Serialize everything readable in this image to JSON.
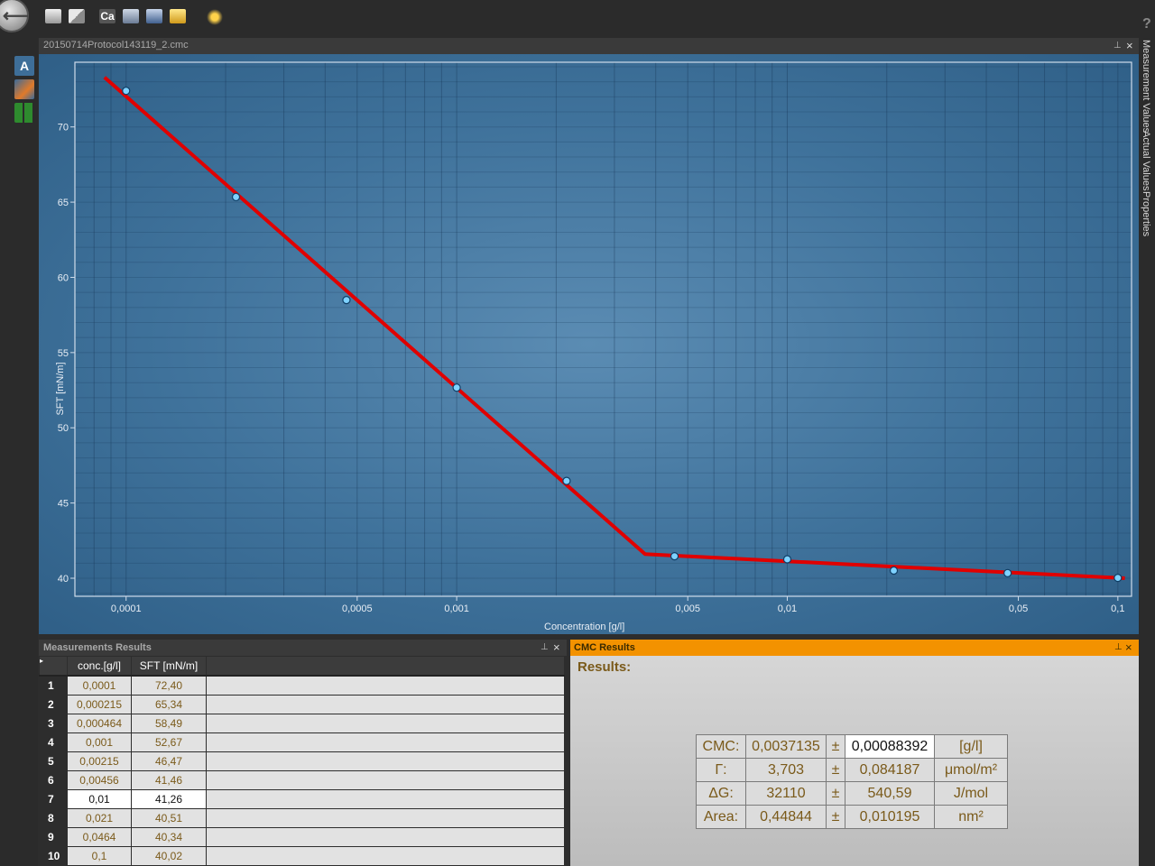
{
  "toolbar": {
    "buttons": [
      {
        "name": "new-folder-icon",
        "label": ""
      },
      {
        "name": "window-icon",
        "label": ""
      },
      {
        "name": "calibrate-button",
        "label": "Ca"
      },
      {
        "name": "print-icon",
        "label": ""
      },
      {
        "name": "save-icon",
        "label": ""
      },
      {
        "name": "open-folder-icon",
        "label": ""
      },
      {
        "name": "wizard-icon",
        "label": ""
      }
    ],
    "help_label": "?"
  },
  "left_rail": {
    "button_a_label": "A"
  },
  "document": {
    "title": "20150714Protocol143119_2.cmc",
    "pin": "⊥",
    "close": "×"
  },
  "chart_data": {
    "type": "line",
    "x_scale": "log",
    "xlabel": "Concentration [g/l]",
    "ylabel": "SFT [mN/m]",
    "xlim": [
      7e-05,
      0.11
    ],
    "ylim": [
      38.8,
      74.3
    ],
    "x_ticks": [
      {
        "value": 0.0001,
        "label": "0,0001"
      },
      {
        "value": 0.0005,
        "label": "0,0005"
      },
      {
        "value": 0.001,
        "label": "0,001"
      },
      {
        "value": 0.005,
        "label": "0,005"
      },
      {
        "value": 0.01,
        "label": "0,01"
      },
      {
        "value": 0.05,
        "label": "0,05"
      },
      {
        "value": 0.1,
        "label": "0,1"
      }
    ],
    "y_ticks": [
      {
        "value": 40,
        "label": "40"
      },
      {
        "value": 45,
        "label": "45"
      },
      {
        "value": 50,
        "label": "50"
      },
      {
        "value": 55,
        "label": "55"
      },
      {
        "value": 60,
        "label": "60"
      },
      {
        "value": 65,
        "label": "65"
      },
      {
        "value": 70,
        "label": "70"
      }
    ],
    "series": [
      {
        "type": "scatter",
        "x": [
          0.0001,
          0.000215,
          0.000464,
          0.001,
          0.00215,
          0.00456,
          0.01,
          0.021,
          0.0464,
          0.1
        ],
        "y": [
          72.4,
          65.34,
          58.49,
          52.67,
          46.47,
          41.46,
          41.26,
          40.51,
          40.34,
          40.02
        ]
      },
      {
        "type": "line",
        "x": [
          8.6e-05,
          0.0037135,
          0.105
        ],
        "y": [
          73.3,
          41.6,
          40.0
        ],
        "color": "#e00000"
      }
    ],
    "grid": true
  },
  "right_dock": {
    "tabs": [
      "Measurement Values",
      "Actual Values",
      "Properties"
    ]
  },
  "measurements": {
    "title": "Measurements Results",
    "columns": [
      "conc.[g/l]",
      "SFT [mN/m]"
    ],
    "rows": [
      {
        "n": "1",
        "conc": "0,0001",
        "sft": "72,40"
      },
      {
        "n": "2",
        "conc": "0,000215",
        "sft": "65,34"
      },
      {
        "n": "3",
        "conc": "0,000464",
        "sft": "58,49"
      },
      {
        "n": "4",
        "conc": "0,001",
        "sft": "52,67"
      },
      {
        "n": "5",
        "conc": "0,00215",
        "sft": "46,47"
      },
      {
        "n": "6",
        "conc": "0,00456",
        "sft": "41,46"
      },
      {
        "n": "7",
        "conc": "0,01",
        "sft": "41,26"
      },
      {
        "n": "8",
        "conc": "0,021",
        "sft": "40,51"
      },
      {
        "n": "9",
        "conc": "0,0464",
        "sft": "40,34"
      },
      {
        "n": "10",
        "conc": "0,1",
        "sft": "40,02"
      }
    ],
    "selected_row": 7
  },
  "cmc": {
    "title": "CMC Results",
    "results_label": "Results:",
    "rows": [
      {
        "label": "CMC:",
        "value": "0,0037135",
        "pm": "±",
        "err": "0,00088392",
        "unit": "[g/l]"
      },
      {
        "label": "Γ:",
        "value": "3,703",
        "pm": "±",
        "err": "0,084187",
        "unit": "μmol/m²"
      },
      {
        "label": "ΔG:",
        "value": "32110",
        "pm": "±",
        "err": "540,59",
        "unit": "J/mol"
      },
      {
        "label": "Area:",
        "value": "0,44844",
        "pm": "±",
        "err": "0,010195",
        "unit": "nm²"
      }
    ]
  }
}
